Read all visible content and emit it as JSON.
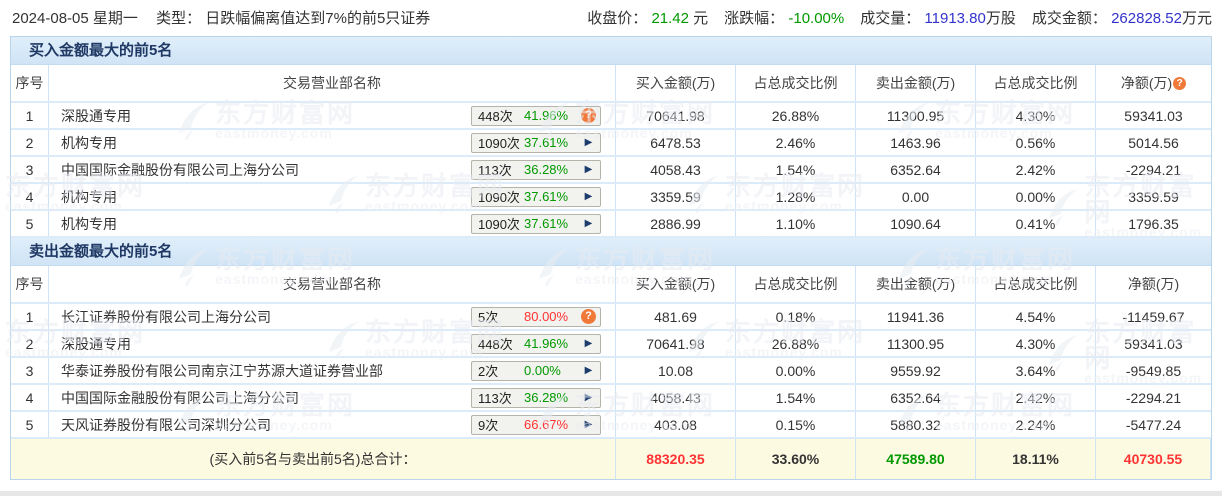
{
  "colors": {
    "red": "#ff3333",
    "green": "#009900",
    "blue": "#3333cc",
    "title_bar_bg": "#d7e8f7",
    "border_blue": "#cfe3f5",
    "total_row_bg": "#fdfae2",
    "help_icon_orange": "#f0793a"
  },
  "header": {
    "date_line": "2024-08-05 星期一",
    "type_label": "类型：",
    "type_value": "日跌幅偏离值达到7%的前5只证券",
    "stats": [
      {
        "label": "收盘价：",
        "value": "21.42",
        "suffix": " 元",
        "color": "green"
      },
      {
        "label": "涨跌幅：",
        "value": "-10.00%",
        "suffix": "",
        "color": "green"
      },
      {
        "label": "成交量：",
        "value": "11913.80",
        "suffix": "万股",
        "color": "blue"
      },
      {
        "label": "成交金额：",
        "value": "262828.52",
        "suffix": "万元",
        "color": "blue"
      }
    ]
  },
  "columns": {
    "seq": "序号",
    "name": "交易营业部名称",
    "buy": "买入金额(万)",
    "buy_ratio": "占总成交比例",
    "sell": "卖出金额(万)",
    "sell_ratio": "占总成交比例",
    "net": "净额(万)"
  },
  "help_icon_glyph": "?",
  "arrow_icon_glyph": "▶",
  "buy_table": {
    "title": "买入金额最大的前5名",
    "net_header_help_icon": true,
    "rows": [
      {
        "seq": "1",
        "name": "深股通专用",
        "times": "448次",
        "pct": "41.96%",
        "pct_color": "green",
        "icon": "help",
        "buy": "70641.98",
        "buy_color": "red",
        "buy_ratio": "26.88%",
        "sell": "11300.95",
        "sell_color": "green",
        "sell_ratio": "4.30%",
        "net": "59341.03",
        "net_color": "red"
      },
      {
        "seq": "2",
        "name": "机构专用",
        "times": "1090次",
        "pct": "37.61%",
        "pct_color": "green",
        "icon": "arrow",
        "buy": "6478.53",
        "buy_color": "red",
        "buy_ratio": "2.46%",
        "sell": "1463.96",
        "sell_color": "green",
        "sell_ratio": "0.56%",
        "net": "5014.56",
        "net_color": "red"
      },
      {
        "seq": "3",
        "name": "中国国际金融股份有限公司上海分公司",
        "times": "113次",
        "pct": "36.28%",
        "pct_color": "green",
        "icon": "arrow",
        "buy": "4058.43",
        "buy_color": "red",
        "buy_ratio": "1.54%",
        "sell": "6352.64",
        "sell_color": "green",
        "sell_ratio": "2.42%",
        "net": "-2294.21",
        "net_color": "green"
      },
      {
        "seq": "4",
        "name": "机构专用",
        "times": "1090次",
        "pct": "37.61%",
        "pct_color": "green",
        "icon": "arrow",
        "buy": "3359.59",
        "buy_color": "red",
        "buy_ratio": "1.28%",
        "sell": "0.00",
        "sell_color": "black",
        "sell_ratio": "0.00%",
        "net": "3359.59",
        "net_color": "red"
      },
      {
        "seq": "5",
        "name": "机构专用",
        "times": "1090次",
        "pct": "37.61%",
        "pct_color": "green",
        "icon": "arrow",
        "buy": "2886.99",
        "buy_color": "red",
        "buy_ratio": "1.10%",
        "sell": "1090.64",
        "sell_color": "green",
        "sell_ratio": "0.41%",
        "net": "1796.35",
        "net_color": "red"
      }
    ]
  },
  "sell_table": {
    "title": "卖出金额最大的前5名",
    "net_header_help_icon": false,
    "rows": [
      {
        "seq": "1",
        "name": "长江证券股份有限公司上海分公司",
        "times": "5次",
        "pct": "80.00%",
        "pct_color": "red",
        "icon": "help",
        "buy": "481.69",
        "buy_color": "red",
        "buy_ratio": "0.18%",
        "sell": "11941.36",
        "sell_color": "green",
        "sell_ratio": "4.54%",
        "net": "-11459.67",
        "net_color": "green"
      },
      {
        "seq": "2",
        "name": "深股通专用",
        "times": "448次",
        "pct": "41.96%",
        "pct_color": "green",
        "icon": "arrow",
        "buy": "70641.98",
        "buy_color": "red",
        "buy_ratio": "26.88%",
        "sell": "11300.95",
        "sell_color": "green",
        "sell_ratio": "4.30%",
        "net": "59341.03",
        "net_color": "red"
      },
      {
        "seq": "3",
        "name": "华泰证券股份有限公司南京江宁苏源大道证券营业部",
        "times": "2次",
        "pct": "0.00%",
        "pct_color": "green",
        "icon": "arrow",
        "buy": "10.08",
        "buy_color": "red",
        "buy_ratio": "0.00%",
        "sell": "9559.92",
        "sell_color": "green",
        "sell_ratio": "3.64%",
        "net": "-9549.85",
        "net_color": "green"
      },
      {
        "seq": "4",
        "name": "中国国际金融股份有限公司上海分公司",
        "times": "113次",
        "pct": "36.28%",
        "pct_color": "green",
        "icon": "arrow",
        "buy": "4058.43",
        "buy_color": "red",
        "buy_ratio": "1.54%",
        "sell": "6352.64",
        "sell_color": "green",
        "sell_ratio": "2.42%",
        "net": "-2294.21",
        "net_color": "green"
      },
      {
        "seq": "5",
        "name": "天风证券股份有限公司深圳分公司",
        "times": "9次",
        "pct": "66.67%",
        "pct_color": "red",
        "icon": "arrow",
        "buy": "403.08",
        "buy_color": "red",
        "buy_ratio": "0.15%",
        "sell": "5880.32",
        "sell_color": "green",
        "sell_ratio": "2.24%",
        "net": "-5477.24",
        "net_color": "green"
      }
    ]
  },
  "total_row": {
    "label": "(买入前5名与卖出前5名)总合计：",
    "buy": "88320.35",
    "buy_color": "red",
    "buy_ratio": "33.60%",
    "sell": "47589.80",
    "sell_color": "green",
    "sell_ratio": "18.11%",
    "net": "40730.55",
    "net_color": "red"
  },
  "watermark": {
    "cn": "东方财富网",
    "en": "eastmoney.com"
  }
}
